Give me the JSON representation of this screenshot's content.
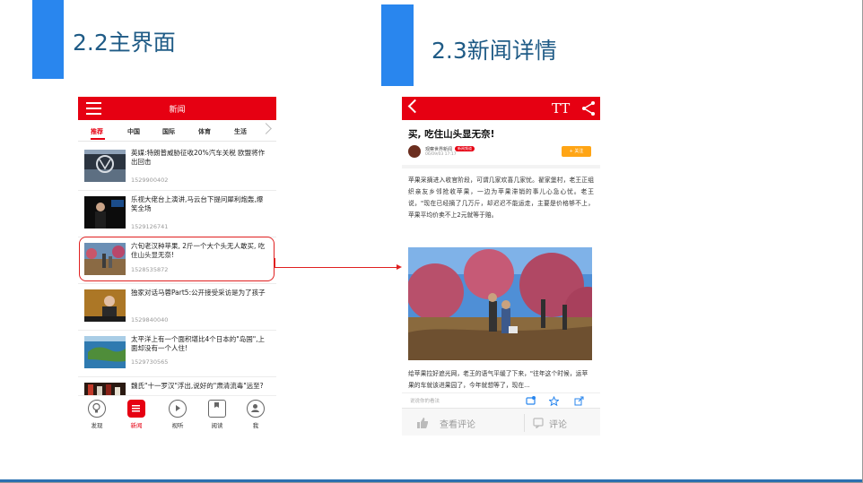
{
  "sections": {
    "left_title": "2.2主界面",
    "right_title": "2.3新闻详情"
  },
  "colors": {
    "accent": "#2986ee",
    "app_red": "#e60012",
    "follow_orange": "#ffa515"
  },
  "list_screen": {
    "header_title": "新闻",
    "menu_icon": "hamburger-icon",
    "tabs": [
      {
        "label": "推荐",
        "active": true
      },
      {
        "label": "中国",
        "active": false
      },
      {
        "label": "国际",
        "active": false
      },
      {
        "label": "体育",
        "active": false
      },
      {
        "label": "生活",
        "active": false
      }
    ],
    "news": [
      {
        "title": "英媒:特朗普威胁征收20%汽车关税 欧盟将作出回击",
        "meta": "1529900402"
      },
      {
        "title": "乐视大佬台上演讲,马云台下提问犀利炮轰,爆笑全场",
        "meta": "1529126741"
      },
      {
        "title": "六旬老汉种苹果, 2斤一个大个头无人敢买, 吃住山头显无奈!",
        "meta": "1528535872"
      },
      {
        "title": "独家对话马蓉Part5:公开接受采访是为了孩子",
        "meta": "1529840040"
      },
      {
        "title": "太平洋上有一个面积堪比4个日本的\"岛国\",上面却没有一个人住!",
        "meta": "1529730565"
      },
      {
        "title": "魏氏\"十一罗汉\"浮出,说好的\"肃清流毒\"远至?",
        "meta": ""
      }
    ],
    "bottom_nav": [
      {
        "label": "发现",
        "icon": "bulb-icon",
        "active": false
      },
      {
        "label": "新闻",
        "icon": "news-icon",
        "active": true
      },
      {
        "label": "视听",
        "icon": "play-icon",
        "active": false
      },
      {
        "label": "阅读",
        "icon": "bookmark-icon",
        "active": false
      },
      {
        "label": "我",
        "icon": "user-icon",
        "active": false
      }
    ]
  },
  "detail_screen": {
    "font_toggle": "TT",
    "headline": "买, 吃住山头显无奈!",
    "source": "观察世界新闻",
    "badge": "新闻频道",
    "date": "06/09/03 17:17",
    "follow_label": "+ 关注",
    "body_1": "苹果采摘进入收官阶段，可谓几家欢喜几家忧。翟家堡村，老王正组织亲友乡邻抢收苹果，一边为苹果滞销的事儿心急心忧。老王说，\"现在已经摘了几万斤，却迟迟不能运走，主要是价格够不上，苹果平均价卖不上2元就等于赔。",
    "body_2": "给苹果拉好遮光网，老王的语气平缓了下来，\"往年这个时候，运苹果的车就该进果园了，今年就想等了，现在...",
    "comment_placeholder": "说说你的看法",
    "view_comments": "查看评论",
    "comment": "评论"
  }
}
